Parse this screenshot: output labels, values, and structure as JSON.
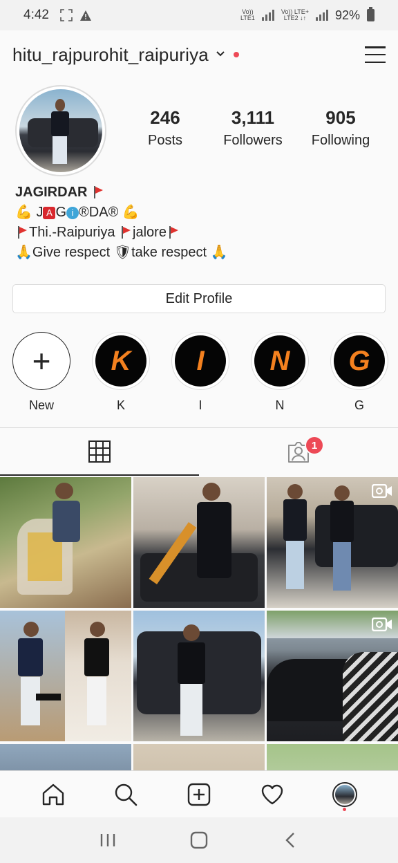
{
  "status_bar": {
    "time": "4:42",
    "net1_top": "Vo)) ",
    "net1_bot": "LTE1",
    "net2_top": "Vo)) LTE+",
    "net2_bot": "LTE2 ↓↑",
    "battery": "92%"
  },
  "header": {
    "username": "hitu_rajpurohit_raipuriya"
  },
  "profile": {
    "stats": [
      {
        "value": "246",
        "label": "Posts"
      },
      {
        "value": "3,111",
        "label": "Followers"
      },
      {
        "value": "905",
        "label": "Following"
      }
    ],
    "bio": {
      "name": "JAGIRDAR",
      "line2_a": "J",
      "line2_b": "G",
      "line2_c": "DA",
      "line3_a": "Thi.-Raipuriya ",
      "line3_b": "jalore",
      "line4_a": "Give respect ",
      "line4_b": "take respect "
    },
    "edit_button": "Edit Profile"
  },
  "highlights": [
    {
      "label": "New",
      "letter": "+"
    },
    {
      "label": "K",
      "letter": "K"
    },
    {
      "label": "I",
      "letter": "I"
    },
    {
      "label": "N",
      "letter": "N"
    },
    {
      "label": "G",
      "letter": "G"
    }
  ],
  "tabs": {
    "tagged_badge": "1"
  },
  "colors": {
    "accent_red": "#ed4956",
    "highlight_letter": "#f4811f"
  }
}
